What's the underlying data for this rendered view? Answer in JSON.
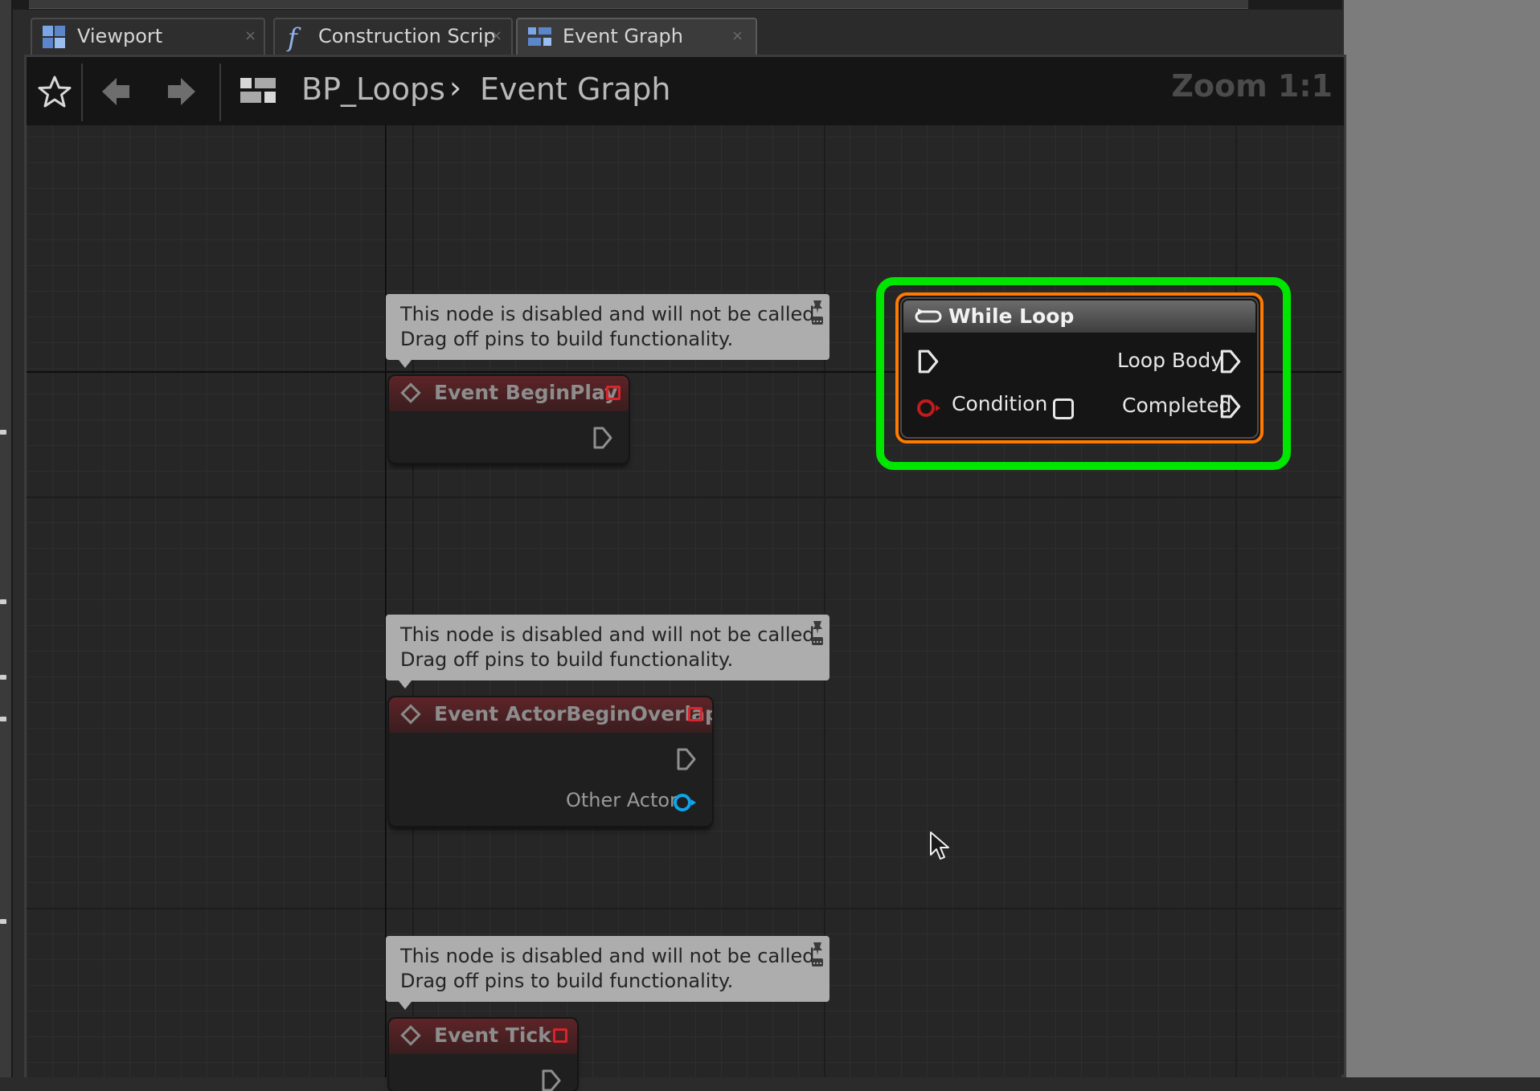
{
  "tabs": [
    {
      "label": "Viewport",
      "icon": "viewport-icon",
      "active": false
    },
    {
      "label": "Construction Scrip",
      "icon": "function-icon",
      "active": false
    },
    {
      "label": "Event Graph",
      "icon": "event-graph-icon",
      "active": true
    }
  ],
  "tab_close_glyph": "×",
  "breadcrumb": {
    "blueprint": "BP_Loops",
    "separator": "›",
    "graph": "Event Graph"
  },
  "zoom": "Zoom 1:1",
  "comments": [
    {
      "line1": "This node is disabled and will not be called.",
      "line2": "Drag off pins to build functionality."
    },
    {
      "line1": "This node is disabled and will not be called.",
      "line2": "Drag off pins to build functionality."
    },
    {
      "line1": "This node is disabled and will not be called.",
      "line2": "Drag off pins to build functionality."
    }
  ],
  "nodes": {
    "begin_play": {
      "title": "Event BeginPlay"
    },
    "actor_begin_overlap": {
      "title": "Event ActorBeginOverlap",
      "pin": "Other Actor"
    },
    "tick": {
      "title": "Event Tick"
    }
  },
  "while_loop": {
    "title": "While Loop",
    "pins": {
      "condition": "Condition",
      "loop_body": "Loop Body",
      "completed": "Completed"
    }
  },
  "colors": {
    "selection": "#00e600",
    "node_outline": "#ff7a00",
    "event_header": "#5d2427",
    "object_pin": "#0ea5e9",
    "bool_pin": "#c11b1b"
  }
}
